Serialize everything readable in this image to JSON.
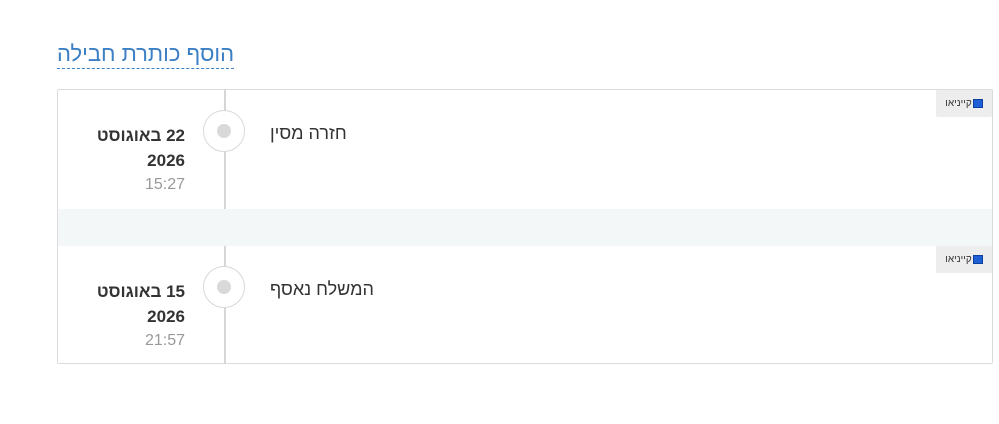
{
  "header": {
    "add_title_link": "הוסף כותרת חבילה"
  },
  "events": [
    {
      "day": "22 באוגוסט 2026",
      "time": "15:27",
      "status": "חזרה מסין",
      "carrier": "קייניאו"
    },
    {
      "day": "15 באוגוסט 2026",
      "time": "21:57",
      "status": "המשלח נאסף",
      "carrier": "קייניאו"
    }
  ],
  "colors": {
    "link": "#3b7fc4",
    "separator": "#f3f7f7",
    "badge_bg": "#ededed"
  },
  "icons": {
    "timeline_node": "circle-dot-icon",
    "carrier_logo": "cainiao-logo-icon"
  }
}
